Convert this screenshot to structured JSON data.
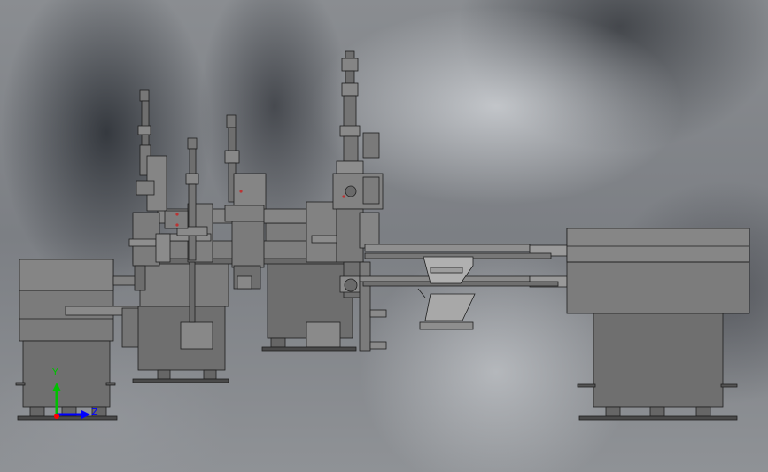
{
  "scene": {
    "description_label": "",
    "colors": {
      "metal_light": "#8c8c8c",
      "metal_mid": "#6f6f6f",
      "metal_dark": "#4a4a4a",
      "edge": "#1e1e1e"
    }
  },
  "triad": {
    "y_label": "Y",
    "z_label": "Z",
    "y_color": "#00c000",
    "z_color": "#0000ff",
    "x_color": "#ff0000"
  }
}
